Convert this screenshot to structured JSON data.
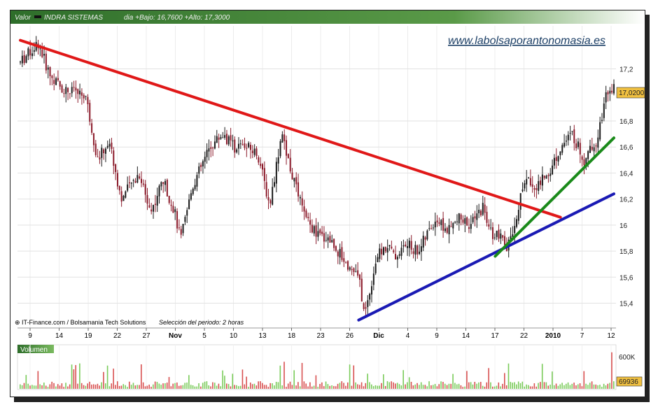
{
  "header": {
    "valor_label": "Valor",
    "instrument": "INDRA SISTEMAS",
    "stats": "dia +Bajo: 16,7600 +Alto: 17,3000"
  },
  "watermark": "www.labolsaporantonomasia.es",
  "credits": {
    "source": "IT-Finance.com / Bolsamania Tech Solutions",
    "period": "Selección del periodo: 2 horas"
  },
  "volume_panel": {
    "title": "Volumen",
    "axis_label": "600K",
    "last_value": "69936"
  },
  "price_tag": "17,0200",
  "colors": {
    "header_bg": "#4a8a3a",
    "candle_up": "#1a1a1a",
    "candle_down": "#8b1a2a",
    "resistance": "#e01818",
    "support": "#1a1ab4",
    "support_short": "#1a8a1a",
    "price_tag_bg": "#f0c040",
    "vol_up": "#7acb5a",
    "vol_down": "#d85050"
  },
  "chart_data": {
    "type": "candlestick",
    "title": "INDRA SISTEMAS",
    "ylabel": "",
    "ylim": [
      15.22,
      17.52
    ],
    "y_ticks": [
      "15,4",
      "15,6",
      "15,8",
      "16",
      "16,2",
      "16,4",
      "16,6",
      "16,8",
      "17,2"
    ],
    "x_ticks": [
      {
        "label": "9"
      },
      {
        "label": "14"
      },
      {
        "label": "19"
      },
      {
        "label": "22"
      },
      {
        "label": "27"
      },
      {
        "label": "Nov",
        "bold": true
      },
      {
        "label": "5"
      },
      {
        "label": "10"
      },
      {
        "label": "13"
      },
      {
        "label": "18"
      },
      {
        "label": "23"
      },
      {
        "label": "26"
      },
      {
        "label": "Dic",
        "bold": true
      },
      {
        "label": "4"
      },
      {
        "label": "9"
      },
      {
        "label": "14"
      },
      {
        "label": "17"
      },
      {
        "label": "22"
      },
      {
        "label": "2010",
        "bold": true
      },
      {
        "label": "7"
      },
      {
        "label": "12"
      }
    ],
    "last_price": 17.02,
    "trendlines": [
      {
        "name": "resistance",
        "color": "red",
        "from": {
          "x": 0.0,
          "y": 17.42
        },
        "to": {
          "x": 0.91,
          "y": 16.06
        }
      },
      {
        "name": "support",
        "color": "blue",
        "from": {
          "x": 0.57,
          "y": 15.27
        },
        "to": {
          "x": 1.0,
          "y": 16.24
        }
      },
      {
        "name": "support_short",
        "color": "green",
        "from": {
          "x": 0.8,
          "y": 15.76
        },
        "to": {
          "x": 1.0,
          "y": 16.67
        }
      }
    ],
    "price_path": [
      [
        0.0,
        17.25
      ],
      [
        0.01,
        17.3
      ],
      [
        0.03,
        17.4
      ],
      [
        0.05,
        17.15
      ],
      [
        0.07,
        17.05
      ],
      [
        0.09,
        17.02
      ],
      [
        0.11,
        17.0
      ],
      [
        0.13,
        16.5
      ],
      [
        0.15,
        16.65
      ],
      [
        0.17,
        16.2
      ],
      [
        0.2,
        16.4
      ],
      [
        0.22,
        16.1
      ],
      [
        0.24,
        16.35
      ],
      [
        0.26,
        16.1
      ],
      [
        0.27,
        15.88
      ],
      [
        0.29,
        16.3
      ],
      [
        0.32,
        16.6
      ],
      [
        0.34,
        16.7
      ],
      [
        0.36,
        16.6
      ],
      [
        0.38,
        16.6
      ],
      [
        0.4,
        16.55
      ],
      [
        0.42,
        16.15
      ],
      [
        0.44,
        16.7
      ],
      [
        0.46,
        16.35
      ],
      [
        0.48,
        16.05
      ],
      [
        0.5,
        15.92
      ],
      [
        0.52,
        15.9
      ],
      [
        0.55,
        15.7
      ],
      [
        0.57,
        15.6
      ],
      [
        0.58,
        15.3
      ],
      [
        0.6,
        15.75
      ],
      [
        0.62,
        15.85
      ],
      [
        0.63,
        15.75
      ],
      [
        0.65,
        15.85
      ],
      [
        0.67,
        15.8
      ],
      [
        0.7,
        16.05
      ],
      [
        0.72,
        15.95
      ],
      [
        0.74,
        16.05
      ],
      [
        0.76,
        16.0
      ],
      [
        0.78,
        16.15
      ],
      [
        0.79,
        15.95
      ],
      [
        0.81,
        15.9
      ],
      [
        0.82,
        15.8
      ],
      [
        0.84,
        16.15
      ],
      [
        0.85,
        16.35
      ],
      [
        0.87,
        16.3
      ],
      [
        0.89,
        16.4
      ],
      [
        0.91,
        16.6
      ],
      [
        0.93,
        16.7
      ],
      [
        0.95,
        16.5
      ],
      [
        0.97,
        16.65
      ],
      [
        0.99,
        17.05
      ]
    ],
    "volume_ylim": [
      0,
      800000
    ]
  }
}
